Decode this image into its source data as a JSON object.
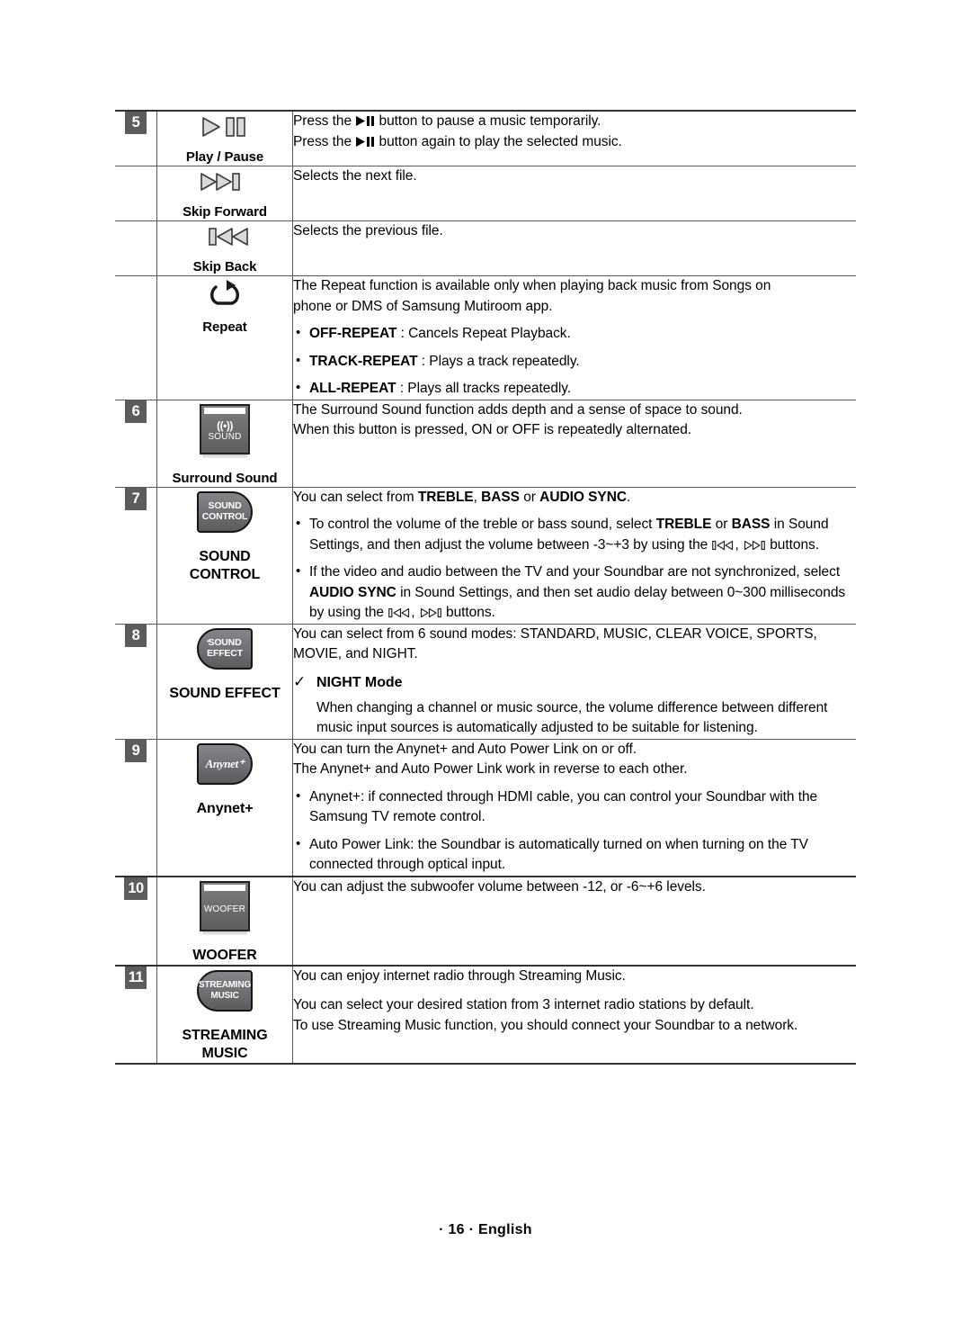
{
  "document": {
    "footer": "· 16 · English"
  },
  "rows": [
    {
      "number": "5",
      "icon_name": "play-pause-icon",
      "label": "Play / Pause",
      "desc_lines": [
        "Press the ▶❙❙ button to pause a music temporarily.",
        "Press the ▶❙❙ button again to play the selected music."
      ]
    },
    {
      "number": "",
      "icon_name": "skip-forward-icon",
      "label": "Skip Forward",
      "desc_lines": [
        "Selects the next file."
      ]
    },
    {
      "number": "",
      "icon_name": "skip-back-icon",
      "label": "Skip Back",
      "desc_lines": [
        "Selects the previous file."
      ]
    },
    {
      "number": "",
      "icon_name": "repeat-icon",
      "label": "Repeat",
      "desc_lines": [
        "The Repeat function is available only when playing back music from Songs on",
        "phone or DMS of Samsung Mutiroom app."
      ],
      "bullets": [
        {
          "bold": "OFF-REPEAT",
          "rest": " : Cancels Repeat Playback."
        },
        {
          "bold": "TRACK-REPEAT",
          "rest": " : Plays a track repeatedly."
        },
        {
          "bold": "ALL-REPEAT",
          "rest": " : Plays all tracks repeatedly."
        }
      ]
    },
    {
      "number": "6",
      "icon_name": "surround-sound-button",
      "button_line1": "((•))",
      "button_line2": "SOUND",
      "label": "Surround Sound",
      "desc_lines": [
        "The Surround Sound function adds depth and a sense of space to sound.",
        "When this button is pressed, ON or OFF is repeatedly alternated."
      ]
    },
    {
      "number": "7",
      "icon_name": "sound-control-button",
      "button_line1": "SOUND",
      "button_line2": "CONTROL",
      "label": "SOUND CONTROL",
      "label_line1": "SOUND",
      "label_line2": "CONTROL",
      "intro": "You can select from TREBLE, BASS or AUDIO SYNC.",
      "bullets_rich": [
        "To control the volume of the treble or bass sound, select TREBLE or BASS in Sound Settings, and then adjust the volume between -3~+3 by using the ⏮ , ⏭ buttons.",
        "If the video and audio between the TV and your Soundbar are not synchronized, select AUDIO SYNC in Sound Settings, and then set audio delay between 0~300 milliseconds by using the ⏮ , ⏭ buttons."
      ]
    },
    {
      "number": "8",
      "icon_name": "sound-effect-button",
      "button_line1": "SOUND",
      "button_line2": "EFFECT",
      "label": "SOUND EFFECT",
      "desc_lines": [
        "You can select from 6 sound modes: STANDARD, MUSIC, CLEAR VOICE, SPORTS,",
        "MOVIE, and NIGHT."
      ],
      "check_head": "NIGHT Mode",
      "check_body": "When changing a channel or music source, the volume difference between different music input sources is automatically adjusted to be suitable for listening."
    },
    {
      "number": "9",
      "icon_name": "anynet-button",
      "button_text": "Anynet⁺",
      "label": "Anynet+",
      "desc_lines": [
        "You can turn the Anynet+ and Auto Power Link on or off.",
        "The Anynet+ and Auto Power Link work in reverse to each other."
      ],
      "bullets_plain": [
        "Anynet+: if connected through HDMI cable, you can control your Soundbar with the Samsung TV remote control.",
        "Auto Power Link: the Soundbar is automatically turned on when turning on the TV connected through optical input."
      ]
    },
    {
      "number": "10",
      "icon_name": "woofer-button",
      "button_line1": "WOOFER",
      "label": "WOOFER",
      "desc_lines": [
        "You can adjust the subwoofer volume between -12, or -6~+6 levels."
      ]
    },
    {
      "number": "11",
      "icon_name": "streaming-music-button",
      "button_line1": "STREAMING",
      "button_line2": "MUSIC",
      "label_line1": "STREAMING",
      "label_line2": "MUSIC",
      "desc_lines": [
        "You can enjoy internet radio through Streaming Music.",
        "You can select your desired station from 3 internet radio stations by default.",
        "To use Streaming Music function, you should connect your Soundbar to a network."
      ]
    }
  ],
  "colors": {
    "badge_bg": "#5b5c5e",
    "rule_thin": "#58595b",
    "rule_thick": "#2f3133",
    "button_face": "#6e6f71",
    "text": "#000000"
  }
}
